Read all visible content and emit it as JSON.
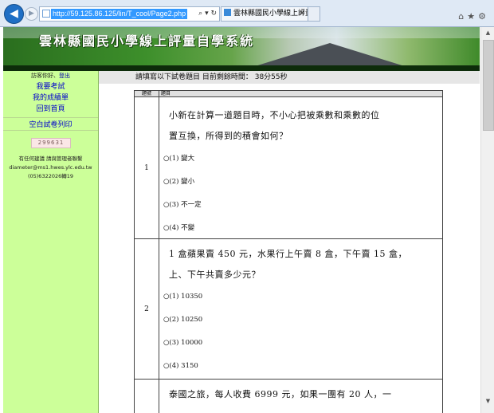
{
  "browser": {
    "url": "http://59.125.86.125/lin/T_cool/Page2.php",
    "address_icons": "⌕ ▾ ↻",
    "tab_title": "雲林縣國民小學線上評量自...",
    "tab_close": "×",
    "window_icons": "⌂★⚙"
  },
  "banner": {
    "title": "雲林縣國民小學線上評量自學系統"
  },
  "sidebar": {
    "greeting": "訪客你好、",
    "logout": "登出",
    "items": [
      {
        "label": "我要考試"
      },
      {
        "label": "我的成績單"
      },
      {
        "label": "回到首頁"
      },
      {
        "label": "空白試卷列印"
      }
    ],
    "captcha": "299631",
    "contact_line1": "有任何建議 請與管理者聯繫",
    "contact_email": "diameter@ms1.hwes.ylc.edu.tw",
    "contact_phone": "(05)6322026轉19"
  },
  "main": {
    "timer_text": "請填寫以下試卷題目 目前剩餘時間： 38分55秒",
    "table_headers": {
      "num": "題號",
      "question": "題目"
    },
    "questions": [
      {
        "num": "1",
        "line1": "小新在計算一道題目時，不小心把被乘數和乘數的位",
        "line2": "置互換，所得到的積會如何？",
        "options": [
          "○(1)  變大",
          "○(2)  變小",
          "○(3)  不一定",
          "○(4)  不變"
        ]
      },
      {
        "num": "2",
        "line1": "1 盒蘋果賣 450 元，水果行上午賣 8 盒，下午賣 15 盒，",
        "line2": "上、下午共賣多少元？",
        "options": [
          "○(1)  10350",
          "○(2)  10250",
          "○(3)  10000",
          "○(4)  3150"
        ]
      },
      {
        "num": "",
        "line1": "泰國之旅，每人收費 6999 元，如果一團有 20 人，一"
      }
    ]
  }
}
